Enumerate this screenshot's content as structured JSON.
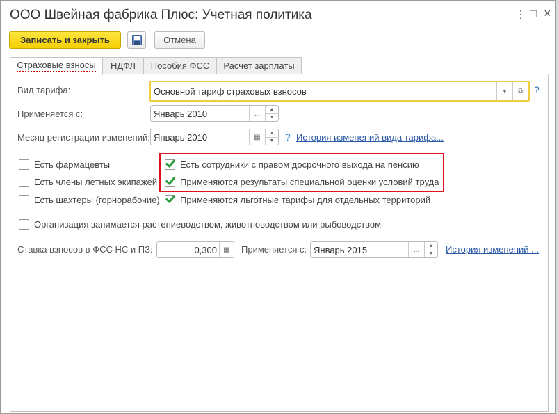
{
  "window": {
    "title": "ООО Швейная фабрика Плюс: Учетная политика",
    "menu_icon": "more-icon",
    "max_icon": "maximize-icon",
    "close_icon": "close-icon"
  },
  "toolbar": {
    "save_close": "Записать и закрыть",
    "cancel": "Отмена"
  },
  "tabs": [
    {
      "label": "Страховые взносы",
      "active": true
    },
    {
      "label": "НДФЛ"
    },
    {
      "label": "Пособия ФСС"
    },
    {
      "label": "Расчет зарплаты"
    }
  ],
  "form": {
    "tariff_label": "Вид тарифа:",
    "tariff_value": "Основной тариф страховых взносов",
    "applies_label": "Применяется с:",
    "applies_value": "Январь 2010",
    "reg_month_label": "Месяц регистрации изменений:",
    "reg_month_value": "Январь 2010",
    "help": "?",
    "history_tariff_link": "История изменений вида тарифа...",
    "checkboxes": [
      {
        "label": "Есть фармацевты",
        "checked": false
      },
      {
        "label": "Есть члены летных экипажей",
        "checked": false
      },
      {
        "label": "Есть шахтеры (горнорабочие)",
        "checked": false
      },
      {
        "label": "Есть сотрудники с правом досрочного выхода на пенсию",
        "checked": true
      },
      {
        "label": "Применяются результаты специальной оценки условий труда",
        "checked": true
      },
      {
        "label": "Применяются льготные тарифы для отдельных территорий",
        "checked": true
      },
      {
        "label": "Организация занимается растениеводством, животноводством или рыбоводством",
        "checked": false
      }
    ],
    "fss_rate_label": "Ставка взносов в ФСС НС и ПЗ:",
    "fss_rate_value": "0,300",
    "fss_applies_label": "Применяется с:",
    "fss_applies_value": "Январь 2015",
    "fss_history_link": "История изменений ...",
    "ellipsis": "...",
    "up": "▲",
    "down": "▼",
    "dropdown": "▼"
  },
  "colors": {
    "highlight": "#e0141e",
    "accent": "#f4cf00"
  }
}
